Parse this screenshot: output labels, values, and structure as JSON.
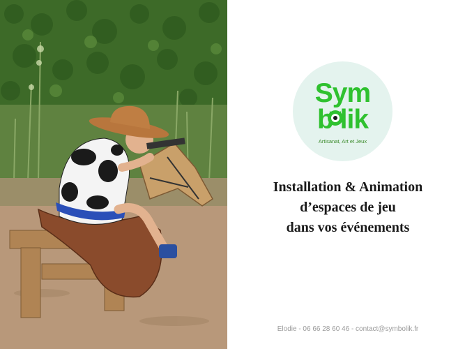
{
  "photo": {
    "description_icon": "child-on-wooden-horse-photo"
  },
  "logo": {
    "line1": "Sym",
    "line2": "b lik",
    "tagline": "Artisanat, Art et Jeux",
    "brand_color": "#2fc12f",
    "background_color": "#e4f3ee"
  },
  "headline": {
    "line1": "Installation & Animation",
    "line2": "d’espaces de jeu",
    "line3": "dans vos événements"
  },
  "contact": {
    "text": "Elodie  - 06 66 28 60 46 - contact@symbolik.fr"
  }
}
